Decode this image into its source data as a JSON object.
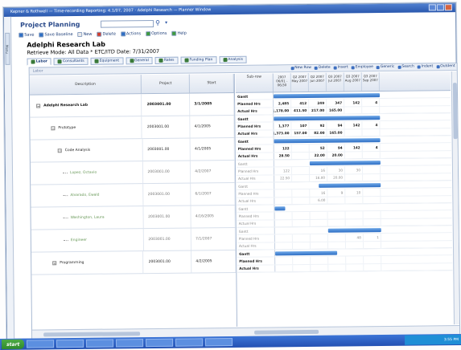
{
  "window": {
    "title": "Kepner & Rothwell — Time-recording Reporting: 4.1/07, 2007 · Adelphi Research — Planner Window"
  },
  "sidebar": {
    "tab_label": "Menu"
  },
  "header": {
    "title": "Project Planning",
    "search_placeholder": ""
  },
  "toolbar": {
    "items": [
      {
        "label": "Save",
        "icon": "save-icon",
        "color": "#2f6fc4"
      },
      {
        "label": "Save Baseline",
        "icon": "baseline-icon",
        "color": "#2f6fc4"
      },
      {
        "label": "New",
        "icon": "new-icon",
        "color": "#eaeaea"
      },
      {
        "label": "Delete",
        "icon": "delete-icon",
        "color": "#d23c2c"
      },
      {
        "label": "Actions",
        "icon": "actions-icon",
        "color": "#2f6fc4"
      },
      {
        "label": "Options",
        "icon": "options-icon",
        "color": "#3f9a3f"
      },
      {
        "label": "Help",
        "icon": "help-icon",
        "color": "#3f9a3f"
      }
    ]
  },
  "project": {
    "title": "Adelphi Research Lab",
    "subtitle": "Retrieve Mode: All Data * ETC/ITD Date: 7/31/2007"
  },
  "tabs": [
    {
      "label": "Labor",
      "active": true
    },
    {
      "label": "Consultants",
      "active": false
    },
    {
      "label": "Equipment",
      "active": false
    },
    {
      "label": "General",
      "active": false
    },
    {
      "label": "Rates",
      "active": false
    },
    {
      "label": "Funding Plan",
      "active": false
    },
    {
      "label": "Analysis",
      "active": false
    }
  ],
  "grid_toolbar": {
    "label": "Labor",
    "items": [
      "New Row",
      "Delete",
      "Insert",
      "Employee",
      "Generic",
      "Search",
      "Indent",
      "Outdent"
    ]
  },
  "columns": {
    "description": "Description",
    "project": "Project",
    "start": "Start",
    "subrow": "Sub-row",
    "periods": [
      {
        "top": "2007",
        "bottom": "06/01 - 06/30"
      },
      {
        "top": "Q2 2007",
        "bottom": "May 2007"
      },
      {
        "top": "Q2 2007",
        "bottom": "Jun 2007"
      },
      {
        "top": "Q3 2007",
        "bottom": "Jul 2007"
      },
      {
        "top": "Q3 2007",
        "bottom": "Aug 2007"
      },
      {
        "top": "Q3 2007",
        "bottom": "Sep 2007"
      }
    ]
  },
  "rows": [
    {
      "level": 0,
      "expander": "⊟",
      "description": "Adelphi Research Lab",
      "project": "2003001.00",
      "start": "3/1/2005",
      "bar": {
        "from": 0,
        "to": 6,
        "style": "blue"
      },
      "planned": [
        "2,485",
        "412",
        "249",
        "347",
        "142",
        "4"
      ],
      "actual": [
        "1,178.00",
        "411.50",
        "217.00",
        "165.00",
        "",
        ""
      ]
    },
    {
      "level": 1,
      "expander": "⊟",
      "description": "Prototype",
      "project": "2003001.00",
      "start": "4/1/2005",
      "bar": {
        "from": 0,
        "to": 6,
        "style": "blue"
      },
      "planned": [
        "1,377",
        "107",
        "92",
        "94",
        "142",
        "4"
      ],
      "actual": [
        "1,373.00",
        "157.00",
        "82.00",
        "165.00",
        "",
        ""
      ]
    },
    {
      "level": 2,
      "expander": "⊟",
      "description": "Code Analysis",
      "project": "2003001.00",
      "start": "4/1/2005",
      "bar": {
        "from": 0,
        "to": 6,
        "style": "blue"
      },
      "planned": [
        "122",
        "",
        "52",
        "94",
        "142",
        "4"
      ],
      "actual": [
        "28.50",
        "",
        "22.00",
        "20.00",
        "",
        ""
      ]
    },
    {
      "level": 3,
      "expander": "",
      "description": "Lopez, Octavio",
      "project": "2003001.00",
      "start": "4/2/2007",
      "bar": {
        "from": 2,
        "to": 6,
        "style": "blue"
      },
      "planned": [
        "122",
        "",
        "16",
        "30",
        "30",
        ""
      ],
      "actual": [
        "22.50",
        "",
        "16.00",
        "20.00",
        "",
        ""
      ]
    },
    {
      "level": 3,
      "expander": "",
      "description": "Alvarado, Ewald",
      "project": "2003001.00",
      "start": "6/1/2007",
      "bar": {
        "from": 2.5,
        "to": 6,
        "style": "blue"
      },
      "planned": [
        "",
        "",
        "16",
        "9",
        "10",
        ""
      ],
      "actual": [
        "",
        "",
        "6.00",
        "",
        "",
        ""
      ]
    },
    {
      "level": 3,
      "expander": "",
      "description": "Washington, Laura",
      "project": "2003001.00",
      "start": "4/16/2005",
      "bar": {
        "from": 0,
        "to": 0.6,
        "style": "blue"
      },
      "planned": [
        "",
        "",
        "",
        "",
        "",
        ""
      ],
      "actual": [
        "",
        "",
        "",
        "",
        "",
        ""
      ]
    },
    {
      "level": 3,
      "expander": "",
      "description": "Engineer",
      "project": "2003001.00",
      "start": "7/1/2007",
      "bar": {
        "from": 3,
        "to": 6,
        "style": "blue"
      },
      "planned": [
        "",
        "",
        "",
        "",
        "48",
        "1"
      ],
      "actual": [
        "",
        "",
        "",
        "",
        "",
        ""
      ]
    },
    {
      "level": 1,
      "expander": "⊞",
      "description": "Programming",
      "project": "2003001.00",
      "start": "4/2/2005",
      "bar": {
        "from": 0,
        "to": 3.5,
        "style": "blue"
      },
      "planned": [
        "",
        "",
        "",
        "",
        "",
        ""
      ],
      "actual": [
        "",
        "",
        "",
        "",
        "",
        ""
      ]
    }
  ],
  "subrow_labels": {
    "gantt": "Gantt",
    "planned": "Planned Hrs",
    "actual": "Actual Hrs"
  },
  "taskbar": {
    "start": "start",
    "items": [
      "",
      "",
      "",
      "",
      "",
      "",
      ""
    ],
    "clock": "3:55 PM"
  }
}
